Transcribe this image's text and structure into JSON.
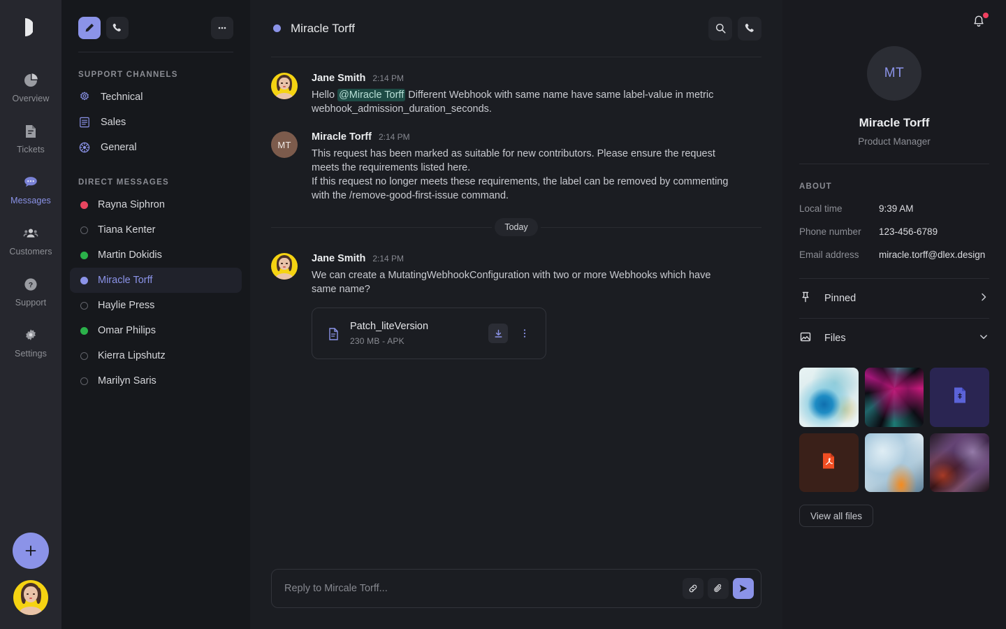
{
  "brand": {
    "logo_icon": "d-logo-icon"
  },
  "rail": {
    "items": [
      {
        "label": "Overview",
        "icon": "pie-chart-icon",
        "active": false
      },
      {
        "label": "Tickets",
        "icon": "ticket-doc-icon",
        "active": false
      },
      {
        "label": "Messages",
        "icon": "chat-bubble-icon",
        "active": true
      },
      {
        "label": "Customers",
        "icon": "people-icon",
        "active": false
      },
      {
        "label": "Support",
        "icon": "help-circle-icon",
        "active": false
      },
      {
        "label": "Settings",
        "icon": "gear-icon",
        "active": false
      }
    ],
    "add_button_icon": "plus-icon",
    "user_avatar_icon": "user-avatar-photo"
  },
  "sidebar": {
    "compose_icon": "pencil-icon",
    "call_icon": "phone-icon",
    "more_icon": "ellipsis-icon",
    "channels_title": "SUPPORT CHANNELS",
    "channels": [
      {
        "label": "Technical",
        "icon": "gear-icon"
      },
      {
        "label": "Sales",
        "icon": "list-receipt-icon"
      },
      {
        "label": "General",
        "icon": "globe-icon"
      }
    ],
    "dm_title": "DIRECT MESSAGES",
    "dms": [
      {
        "label": "Rayna Siphron",
        "status": "red",
        "selected": false
      },
      {
        "label": "Tiana Kenter",
        "status": "empty",
        "selected": false
      },
      {
        "label": "Martin Dokidis",
        "status": "green",
        "selected": false
      },
      {
        "label": "Miracle Torff",
        "status": "purple",
        "selected": true
      },
      {
        "label": "Haylie Press",
        "status": "empty",
        "selected": false
      },
      {
        "label": "Omar Philips",
        "status": "green",
        "selected": false
      },
      {
        "label": "Kierra Lipshutz",
        "status": "empty",
        "selected": false
      },
      {
        "label": "Marilyn Saris",
        "status": "empty",
        "selected": false
      }
    ]
  },
  "chat": {
    "title": "Miracle Torff",
    "status_dot_color": "#8b93e8",
    "search_icon": "search-icon",
    "call_icon": "phone-icon",
    "day_separator": "Today",
    "messages": [
      {
        "author": "Jane Smith",
        "time": "2:14 PM",
        "avatar_kind": "photo",
        "text_before": "Hello ",
        "mention": "@Miracle Torff",
        "text_after": " Different Webhook with same name have same label-value in metric webhook_admission_duration_seconds.",
        "paragraph2": ""
      },
      {
        "author": "Miracle Torff",
        "time": "2:14 PM",
        "avatar_kind": "initials",
        "initials": "MT",
        "text_before": "This request has been marked as suitable for new contributors. Please ensure the request meets the requirements listed here.",
        "mention": "",
        "text_after": "",
        "paragraph2": "If this request no longer meets these requirements, the label can be removed by commenting with the /remove-good-first-issue command."
      },
      {
        "author": "Jane Smith",
        "time": "2:14 PM",
        "avatar_kind": "photo",
        "text_before": "We can create a MutatingWebhookConfiguration with two or more Webhooks which have same name?",
        "mention": "",
        "text_after": "",
        "paragraph2": ""
      }
    ],
    "attachment": {
      "icon": "file-doc-icon",
      "name": "Patch_liteVersion",
      "size": "230 MB",
      "separator": "-",
      "type": "APK",
      "download_icon": "download-icon",
      "more_icon": "vertical-dots-icon"
    },
    "composer": {
      "placeholder": "Reply to Mircale Torff...",
      "value": "",
      "link_icon": "link-icon",
      "attach_icon": "paperclip-icon",
      "send_icon": "send-icon"
    }
  },
  "right_panel": {
    "bell_icon": "bell-icon",
    "has_notification": true,
    "avatar_initials": "MT",
    "name": "Miracle Torff",
    "role": "Product Manager",
    "about_title": "ABOUT",
    "about": [
      {
        "key": "Local time",
        "value": "9:39 AM"
      },
      {
        "key": "Phone number",
        "value": "123-456-6789"
      },
      {
        "key": "Email address",
        "value": "miracle.torff@dlex.design"
      }
    ],
    "pinned": {
      "label": "Pinned",
      "icon": "pin-icon",
      "chevron": "chevron-right-icon"
    },
    "files": {
      "label": "Files",
      "icon": "image-icon",
      "chevron": "chevron-down-icon"
    },
    "thumbnails": [
      {
        "kind": "image",
        "style": "t-ice",
        "name": "ice-bloom-thumbnail"
      },
      {
        "kind": "image",
        "style": "t-magenta",
        "name": "magenta-burst-thumbnail"
      },
      {
        "kind": "document",
        "style": "t-doc-purple",
        "name": "document-file-thumbnail"
      },
      {
        "kind": "document",
        "style": "t-doc-brown",
        "name": "pdf-file-thumbnail"
      },
      {
        "kind": "image",
        "style": "t-sky",
        "name": "sky-swirl-thumbnail"
      },
      {
        "kind": "image",
        "style": "t-purple-smoke",
        "name": "purple-smoke-thumbnail"
      }
    ],
    "view_all_label": "View all files"
  },
  "colors": {
    "accent": "#8b93e8",
    "rail_bg": "#26272e",
    "sidebar_bg": "#16181c",
    "chat_bg": "#1b1d22",
    "panel_bg": "#191a1f",
    "status_red": "#e8455f",
    "status_green": "#2bb14a",
    "notification_red": "#f04060",
    "mention_bg": "#1d4b45"
  }
}
